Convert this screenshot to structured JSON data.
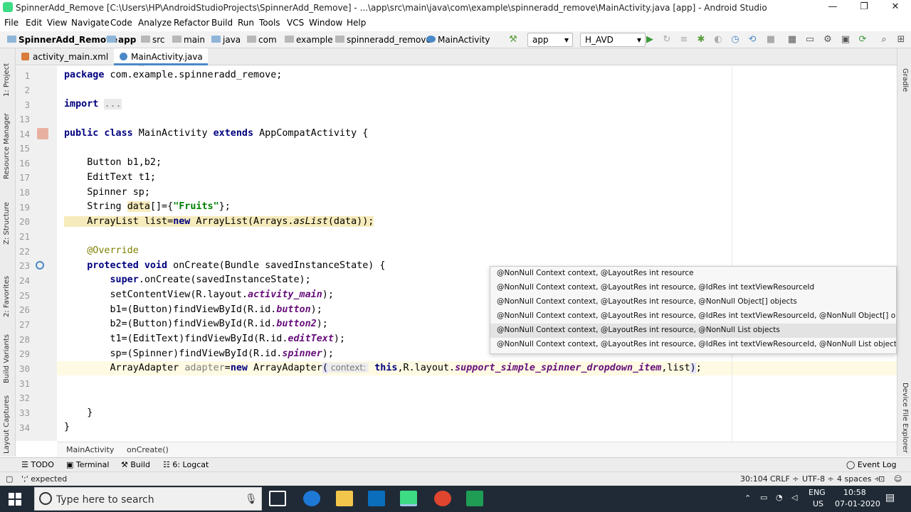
{
  "window": {
    "title": "SpinnerAdd_Remove [C:\\Users\\HP\\AndroidStudioProjects\\SpinnerAdd_Remove] - ...\\app\\src\\main\\java\\com\\example\\spinneradd_remove\\MainActivity.java [app] - Android Studio",
    "minimize": "—",
    "restore": "❐",
    "close": "✕"
  },
  "menu": [
    "File",
    "Edit",
    "View",
    "Navigate",
    "Code",
    "Analyze",
    "Refactor",
    "Build",
    "Run",
    "Tools",
    "VCS",
    "Window",
    "Help"
  ],
  "nav": {
    "project": "SpinnerAdd_Remove",
    "crumbs": [
      "app",
      "src",
      "main",
      "java",
      "com",
      "example",
      "spinneradd_remove",
      "MainActivity"
    ],
    "run_config": "app",
    "device": "H_AVD"
  },
  "tabs": [
    {
      "label": "activity_main.xml",
      "close": "×"
    },
    {
      "label": "MainActivity.java",
      "close": "×"
    }
  ],
  "left_panels": [
    "1: Project",
    "Resource Manager",
    "Z: Structure",
    "2: Favorites",
    "Build Variants",
    "Layout Captures"
  ],
  "right_panels": [
    "Gradle",
    "Device File Explorer"
  ],
  "lines": [
    "1",
    "2",
    "3",
    "13",
    "14",
    "15",
    "16",
    "17",
    "18",
    "19",
    "20",
    "21",
    "22",
    "23",
    "24",
    "25",
    "26",
    "27",
    "28",
    "29",
    "30",
    "31",
    "32",
    "33",
    "34"
  ],
  "code": {
    "l1": [
      "package",
      " com.example.spinneradd_remove;"
    ],
    "l3": [
      "import",
      " ",
      "..."
    ],
    "l14": [
      "public class",
      " MainActivity ",
      "extends",
      " AppCompatActivity {"
    ],
    "l16": "    Button b1,b2;",
    "l17": "    EditText t1;",
    "l18": "    Spinner sp;",
    "l19": [
      "    String ",
      "data",
      "[]={",
      "\"Fruits\"",
      "};"
    ],
    "l20": [
      "    ArrayList list=",
      "new",
      " ArrayList(Arrays.",
      "asList",
      "(data));"
    ],
    "l22": "    @Override",
    "l23": [
      "    ",
      "protected void",
      " onCreate(Bundle savedInstanceState) {"
    ],
    "l24": [
      "        ",
      "super",
      ".onCreate(savedInstanceState);"
    ],
    "l25": [
      "        setContentView(R.layout.",
      "activity_main",
      ");"
    ],
    "l26": [
      "        b1=(Button)findViewById(R.id.",
      "button",
      ");"
    ],
    "l27": [
      "        b2=(Button)findViewById(R.id.",
      "button2",
      ");"
    ],
    "l28": [
      "        t1=(EditText)findViewById(R.id.",
      "editText",
      ");"
    ],
    "l29": [
      "        sp=(Spinner)findViewById(R.id.",
      "spinner",
      ");"
    ],
    "l30": [
      "        ArrayAdapter ",
      "adapter",
      "=",
      "new",
      " ArrayAdapter",
      "(",
      "context:",
      " ",
      "this",
      ",R.layout.",
      "support_simple_spinner_dropdown_item",
      ",list",
      ")",
      ";"
    ],
    "l33": "    }",
    "l34": "}"
  },
  "popup": [
    "@NonNull Context context, @LayoutRes int resource",
    "@NonNull Context context, @LayoutRes int resource, @IdRes int textViewResourceId",
    "@NonNull Context context, @LayoutRes int resource, @NonNull Object[] objects",
    "@NonNull Context context, @LayoutRes int resource, @IdRes int textViewResourceId, @NonNull Object[] objects",
    "@NonNull Context context, @LayoutRes int resource, @NonNull List objects",
    "@NonNull Context context, @LayoutRes int resource, @IdRes int textViewResourceId, @NonNull List objects"
  ],
  "breadcrumbs": [
    "MainActivity",
    "onCreate()"
  ],
  "toolwindows": [
    "TODO",
    "Terminal",
    "Build",
    "6: Logcat",
    "Event Log"
  ],
  "status": {
    "message": "';' expected",
    "position": "30:104",
    "line_sep": "CRLF ÷",
    "encoding": "UTF-8 ÷",
    "indent": "4 spaces ÷"
  },
  "taskbar": {
    "search_placeholder": "Type here to search",
    "lang1": "ENG",
    "lang2": "US",
    "time": "10:58",
    "date": "07-01-2020"
  },
  "colors": {
    "keyword": "#000080",
    "string": "#008000",
    "field": "#660e7a",
    "annotation": "#808000",
    "accent": "#4a88c7"
  }
}
